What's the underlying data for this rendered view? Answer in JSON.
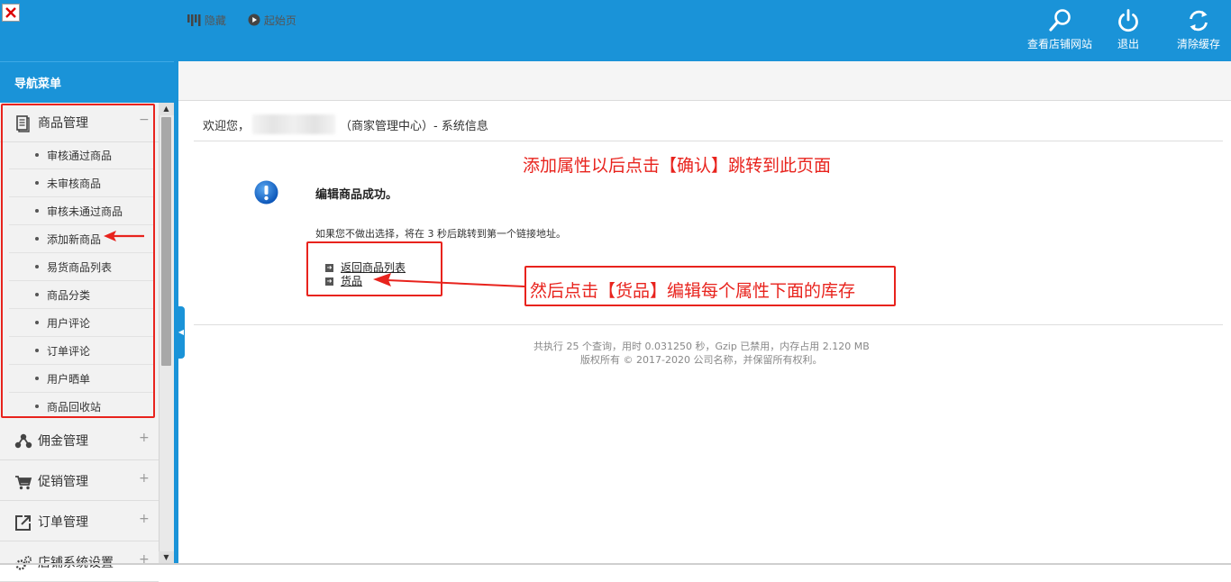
{
  "header": {
    "view_store_label": "查看店铺网站",
    "logout_label": "退出",
    "clear_cache_label": "清除缓存",
    "accent_color": "#1a93d8"
  },
  "sidebar": {
    "title": "导航菜单",
    "groups": [
      {
        "label": "商品管理",
        "toggle": "−",
        "icon": "document-icon",
        "items": [
          {
            "label": "审核通过商品"
          },
          {
            "label": "未审核商品"
          },
          {
            "label": "审核未通过商品"
          },
          {
            "label": "添加新商品"
          },
          {
            "label": "易货商品列表"
          },
          {
            "label": "商品分类"
          },
          {
            "label": "用户评论"
          },
          {
            "label": "订单评论"
          },
          {
            "label": "用户晒单"
          },
          {
            "label": "商品回收站"
          }
        ]
      },
      {
        "label": "佣金管理",
        "toggle": "+",
        "icon": "share-icon"
      },
      {
        "label": "促销管理",
        "toggle": "+",
        "icon": "cart-icon"
      },
      {
        "label": "订单管理",
        "toggle": "+",
        "icon": "export-icon"
      },
      {
        "label": "店铺系统设置",
        "toggle": "+",
        "icon": "gears-icon"
      }
    ]
  },
  "toolbar": {
    "hide_label": "隐藏",
    "start_page_label": "起始页"
  },
  "content": {
    "welcome_prefix": "欢迎您，",
    "welcome_suffix": "（商家管理中心）- 系统信息",
    "message_title": "编辑商品成功。",
    "message_body": "如果您不做出选择，将在 3 秒后跳转到第一个链接地址。",
    "links": [
      "返回商品列表",
      "货品"
    ],
    "footer_line1": "共执行 25 个查询，用时 0.031250 秒，Gzip 已禁用，内存占用 2.120 MB",
    "footer_line2": "版权所有 © 2017-2020 公司名称，并保留所有权利。"
  },
  "annotations": {
    "note_top": "添加属性以后点击【确认】跳转到此页面",
    "note_right": "然后点击【货品】编辑每个属性下面的库存",
    "color": "#e8231d"
  }
}
